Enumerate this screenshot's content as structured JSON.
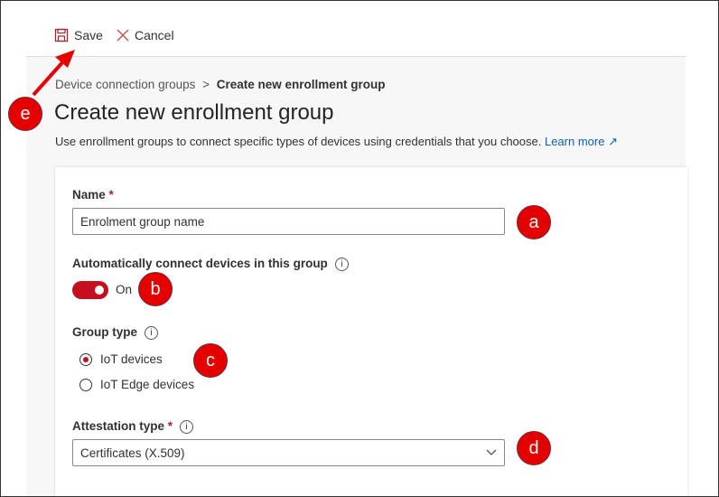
{
  "toolbar": {
    "save_label": "Save",
    "cancel_label": "Cancel"
  },
  "breadcrumb": {
    "parent": "Device connection groups",
    "separator": ">",
    "current": "Create new enrollment group"
  },
  "page": {
    "title": "Create new enrollment group",
    "description": "Use enrollment groups to connect specific types of devices using credentials that you choose.",
    "learn_more": "Learn more"
  },
  "form": {
    "name_label": "Name",
    "required_mark": "*",
    "name_value": "Enrolment group name",
    "auto_connect_label": "Automatically connect devices in this group",
    "toggle_state": "On",
    "toggle_on": true,
    "group_type_label": "Group type",
    "group_types": [
      "IoT devices",
      "IoT Edge devices"
    ],
    "group_type_selected": "IoT devices",
    "attestation_label": "Attestation type",
    "attestation_value": "Certificates (X.509)"
  },
  "annotations": [
    "a",
    "b",
    "c",
    "d",
    "e"
  ],
  "colors": {
    "accent": "#c50f1f",
    "badge": "#e50000",
    "link": "#0f5fb5"
  }
}
